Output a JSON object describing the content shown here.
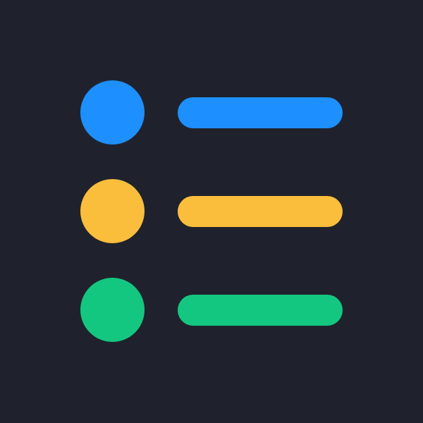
{
  "icon": {
    "name": "list-icon",
    "background_color": "#1f222c",
    "items": [
      {
        "color": "#1e8fff"
      },
      {
        "color": "#fbbe3c"
      },
      {
        "color": "#14c781"
      }
    ]
  }
}
